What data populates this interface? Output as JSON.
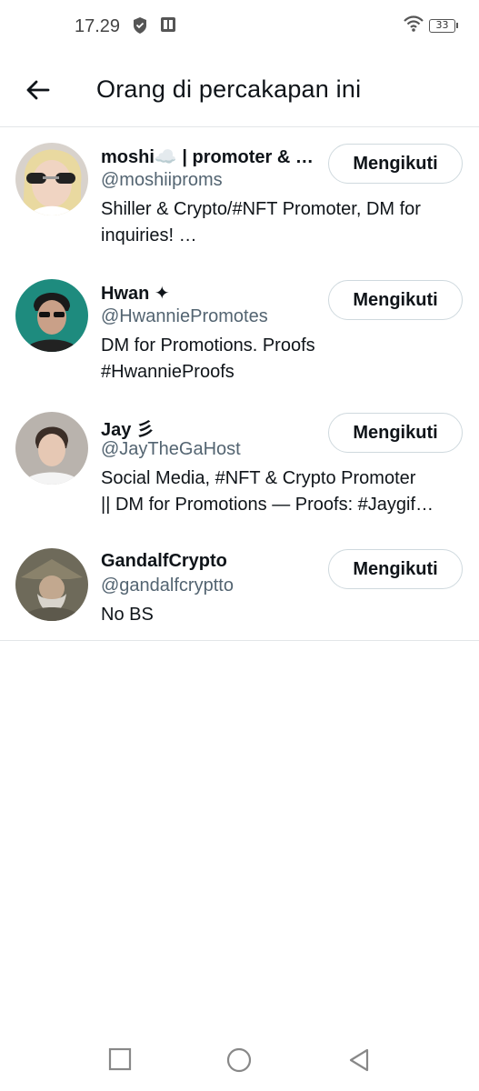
{
  "status_bar": {
    "time": "17.29",
    "battery": "33"
  },
  "header": {
    "title": "Orang di percakapan ini",
    "back_icon": "arrow-left-icon"
  },
  "users": [
    {
      "name": "moshi☁️ | promoter & …",
      "handle": "@moshiiproms",
      "bio_lines": [
        "Shiller & Crypto/#NFT Promoter, DM for",
        "inquiries! …"
      ],
      "follow_label": "Mengikuti"
    },
    {
      "name": "Hwan ✦",
      "handle": "@HwanniePromotes",
      "bio_lines": [
        "DM for Promotions. Proofs",
        "#HwannieProofs"
      ],
      "follow_label": "Mengikuti"
    },
    {
      "name": "Jay 彡",
      "handle": "@JayTheGaHost",
      "bio_lines": [
        "Social Media, #NFT & Crypto Promoter",
        "|| DM for Promotions — Proofs: #Jaygif…"
      ],
      "follow_label": "Mengikuti"
    },
    {
      "name": "GandalfCrypto",
      "handle": "@gandalfcryptto",
      "bio_lines": [
        "No BS"
      ],
      "follow_label": "Mengikuti"
    }
  ],
  "nav": {
    "recent_icon": "square-icon",
    "home_icon": "circle-icon",
    "back_icon": "triangle-back-icon"
  }
}
